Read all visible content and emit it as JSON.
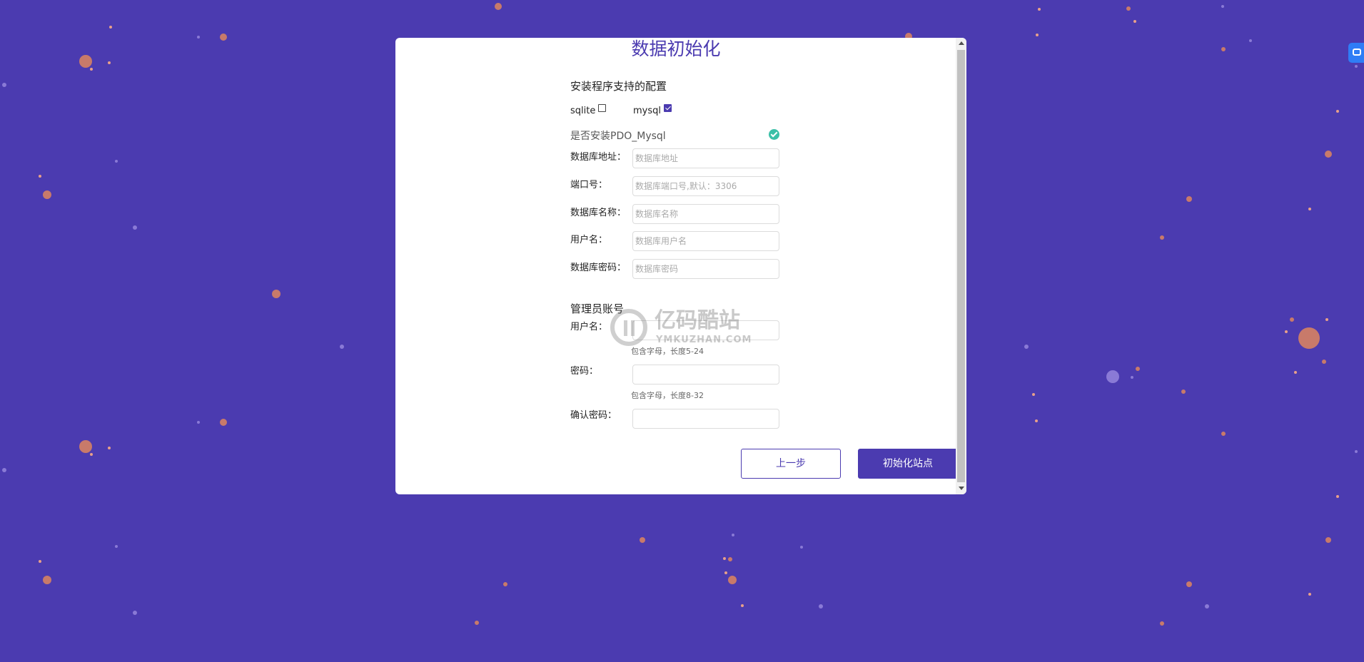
{
  "page": {
    "title": "数据初始化"
  },
  "support": {
    "title": "安装程序支持的配置",
    "options": [
      {
        "label": "sqlite",
        "checked": false
      },
      {
        "label": "mysql",
        "checked": true
      }
    ]
  },
  "pdo": {
    "label": "是否安装PDO_Mysql",
    "status_icon": "check-circle-icon",
    "status_color": "#3cc0a8"
  },
  "database": {
    "fields": [
      {
        "label": "数据库地址：",
        "placeholder": "数据库地址",
        "value": ""
      },
      {
        "label": "端口号：",
        "placeholder": "数据库端口号,默认：3306",
        "value": ""
      },
      {
        "label": "数据库名称：",
        "placeholder": "数据库名称",
        "value": ""
      },
      {
        "label": "用户名：",
        "placeholder": "数据库用户名",
        "value": ""
      },
      {
        "label": "数据库密码：",
        "placeholder": "数据库密码",
        "value": ""
      }
    ]
  },
  "admin": {
    "title": "管理员账号",
    "username": {
      "label": "用户名：",
      "hint": "包含字母，长度5-24"
    },
    "password": {
      "label": "密码：",
      "hint": "包含字母，长度8-32"
    },
    "confirm": {
      "label": "确认密码："
    }
  },
  "buttons": {
    "prev": "上一步",
    "init": "初始化站点"
  },
  "watermark": {
    "text": "亿码酷站",
    "sub": "YMKUZHAN.COM"
  },
  "colors": {
    "background": "#4b3bb0",
    "accent": "#4b3bb0",
    "dot": "#c87a6a",
    "success": "#3cc0a8"
  }
}
